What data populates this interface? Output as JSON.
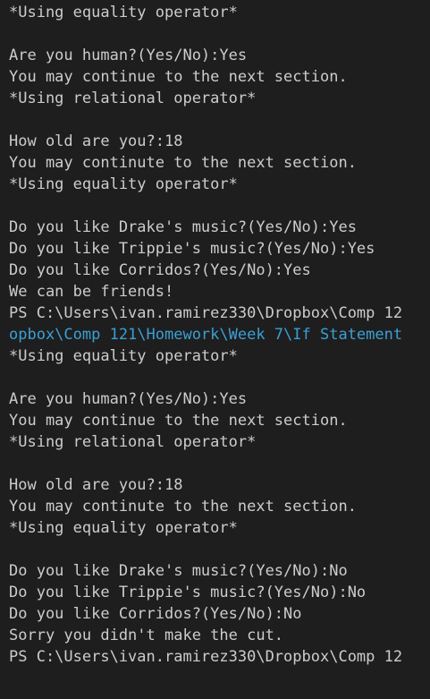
{
  "terminal": {
    "colors": {
      "background": "#1e1e1e",
      "text": "#cccccc",
      "path_highlight": "#3b9fd6"
    },
    "lines": [
      {
        "text": "*Using equality operator*",
        "style": ""
      },
      {
        "text": "",
        "style": ""
      },
      {
        "text": "Are you human?(Yes/No):Yes",
        "style": ""
      },
      {
        "text": "You may continue to the next section.",
        "style": ""
      },
      {
        "text": "*Using relational operator*",
        "style": ""
      },
      {
        "text": "",
        "style": ""
      },
      {
        "text": "How old are you?:18",
        "style": ""
      },
      {
        "text": "You may continute to the next section.",
        "style": ""
      },
      {
        "text": "*Using equality operator*",
        "style": ""
      },
      {
        "text": "",
        "style": ""
      },
      {
        "text": "Do you like Drake's music?(Yes/No):Yes",
        "style": ""
      },
      {
        "text": "Do you like Trippie's music?(Yes/No):Yes",
        "style": ""
      },
      {
        "text": "Do you like Corridos?(Yes/No):Yes",
        "style": ""
      },
      {
        "text": "We can be friends!",
        "style": ""
      },
      {
        "text": "PS C:\\Users\\ivan.ramirez330\\Dropbox\\Comp 12",
        "style": ""
      },
      {
        "text": "opbox\\Comp 121\\Homework\\Week 7\\If Statement",
        "style": "cyan"
      },
      {
        "text": "*Using equality operator*",
        "style": ""
      },
      {
        "text": "",
        "style": ""
      },
      {
        "text": "Are you human?(Yes/No):Yes",
        "style": ""
      },
      {
        "text": "You may continue to the next section.",
        "style": ""
      },
      {
        "text": "*Using relational operator*",
        "style": ""
      },
      {
        "text": "",
        "style": ""
      },
      {
        "text": "How old are you?:18",
        "style": ""
      },
      {
        "text": "You may continute to the next section.",
        "style": ""
      },
      {
        "text": "*Using equality operator*",
        "style": ""
      },
      {
        "text": "",
        "style": ""
      },
      {
        "text": "Do you like Drake's music?(Yes/No):No",
        "style": ""
      },
      {
        "text": "Do you like Trippie's music?(Yes/No):No",
        "style": ""
      },
      {
        "text": "Do you like Corridos?(Yes/No):No",
        "style": ""
      },
      {
        "text": "Sorry you didn't make the cut.",
        "style": ""
      },
      {
        "text": "PS C:\\Users\\ivan.ramirez330\\Dropbox\\Comp 12",
        "style": ""
      }
    ]
  }
}
